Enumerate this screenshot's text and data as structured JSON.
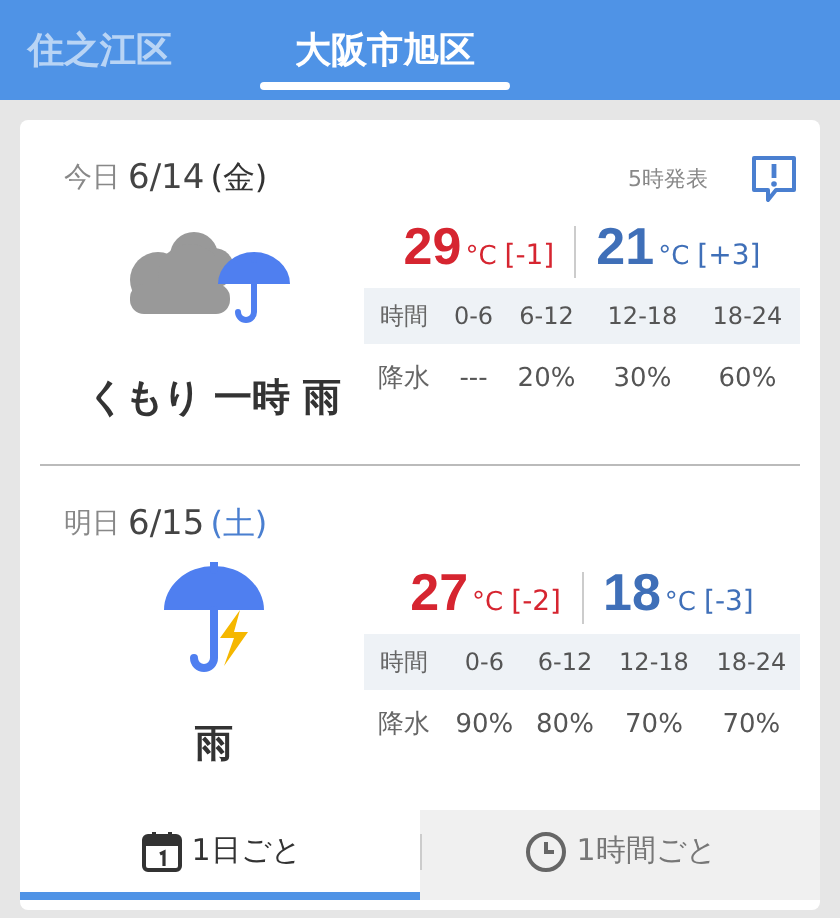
{
  "area_tabs": [
    {
      "label": "住之江区",
      "selected": false
    },
    {
      "label": "大阪市旭区",
      "selected": true
    }
  ],
  "days": [
    {
      "day_label": "今日",
      "date": "6/14",
      "weekday": "(金)",
      "color": "#333333",
      "issued": "5時発表",
      "kind": "cloudrain",
      "weather": "くもり 一時 雨",
      "high": "29",
      "high_unit": "°C",
      "high_diff": "[-1]",
      "low": "21",
      "low_unit": "°C",
      "low_diff": "[+3]",
      "time_header": "時間",
      "periods": [
        "0-6",
        "6-12",
        "12-18",
        "18-24"
      ],
      "rain_header": "降水",
      "rain": [
        "---",
        "20%",
        "30%",
        "60%"
      ]
    },
    {
      "day_label": "明日",
      "date": "6/15",
      "weekday": "(土)",
      "color": "#4a7fd0",
      "kind": "thunder",
      "weather": "雨",
      "high": "27",
      "high_unit": "°C",
      "high_diff": "[-2]",
      "low": "18",
      "low_unit": "°C",
      "low_diff": "[-3]",
      "time_header": "時間",
      "periods": [
        "0-6",
        "6-12",
        "12-18",
        "18-24"
      ],
      "rain_header": "降水",
      "rain": [
        "90%",
        "80%",
        "70%",
        "70%"
      ]
    }
  ],
  "view_tabs": [
    {
      "label": "1日ごと",
      "kind": "daily",
      "selected": true
    },
    {
      "label": "1時間ごと",
      "kind": "hourly",
      "selected": false
    }
  ]
}
